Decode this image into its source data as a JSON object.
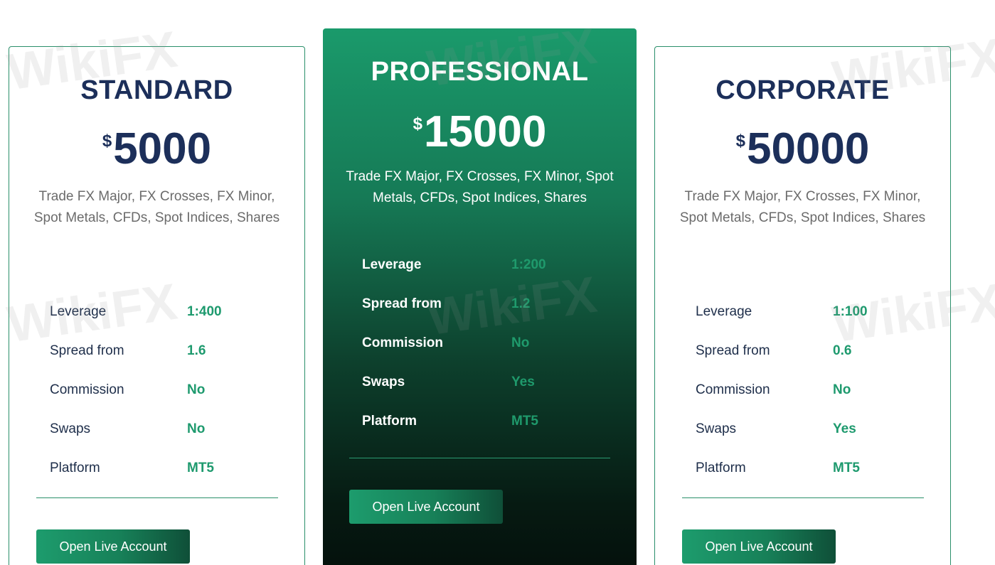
{
  "watermark_text": "WikiFX",
  "plans": [
    {
      "name": "STANDARD",
      "currency": "$",
      "price": "5000",
      "description": "Trade FX Major, FX Crosses, FX Minor, Spot Metals, CFDs, Spot Indices, Shares",
      "specs": [
        {
          "label": "Leverage",
          "value": "1:400"
        },
        {
          "label": "Spread from",
          "value": "1.6"
        },
        {
          "label": "Commission",
          "value": "No"
        },
        {
          "label": "Swaps",
          "value": "No"
        },
        {
          "label": "Platform",
          "value": "MT5"
        }
      ],
      "cta_label": "Open Live Account"
    },
    {
      "name": "PROFESSIONAL",
      "currency": "$",
      "price": "15000",
      "description": "Trade FX Major, FX Crosses, FX Minor, Spot Metals, CFDs, Spot Indices, Shares",
      "specs": [
        {
          "label": "Leverage",
          "value": "1:200"
        },
        {
          "label": "Spread from",
          "value": "1.2"
        },
        {
          "label": "Commission",
          "value": "No"
        },
        {
          "label": "Swaps",
          "value": "Yes"
        },
        {
          "label": "Platform",
          "value": "MT5"
        }
      ],
      "cta_label": "Open Live Account"
    },
    {
      "name": "CORPORATE",
      "currency": "$",
      "price": "50000",
      "description": "Trade FX Major, FX Crosses, FX Minor, Spot Metals, CFDs, Spot Indices, Shares",
      "specs": [
        {
          "label": "Leverage",
          "value": "1:100"
        },
        {
          "label": "Spread from",
          "value": "0.6"
        },
        {
          "label": "Commission",
          "value": "No"
        },
        {
          "label": "Swaps",
          "value": "Yes"
        },
        {
          "label": "Platform",
          "value": "MT5"
        }
      ],
      "cta_label": "Open Live Account"
    }
  ],
  "colors": {
    "heading_navy": "#1c2f5a",
    "value_green": "#1e9a6e",
    "border_green": "#2a8f6a"
  }
}
